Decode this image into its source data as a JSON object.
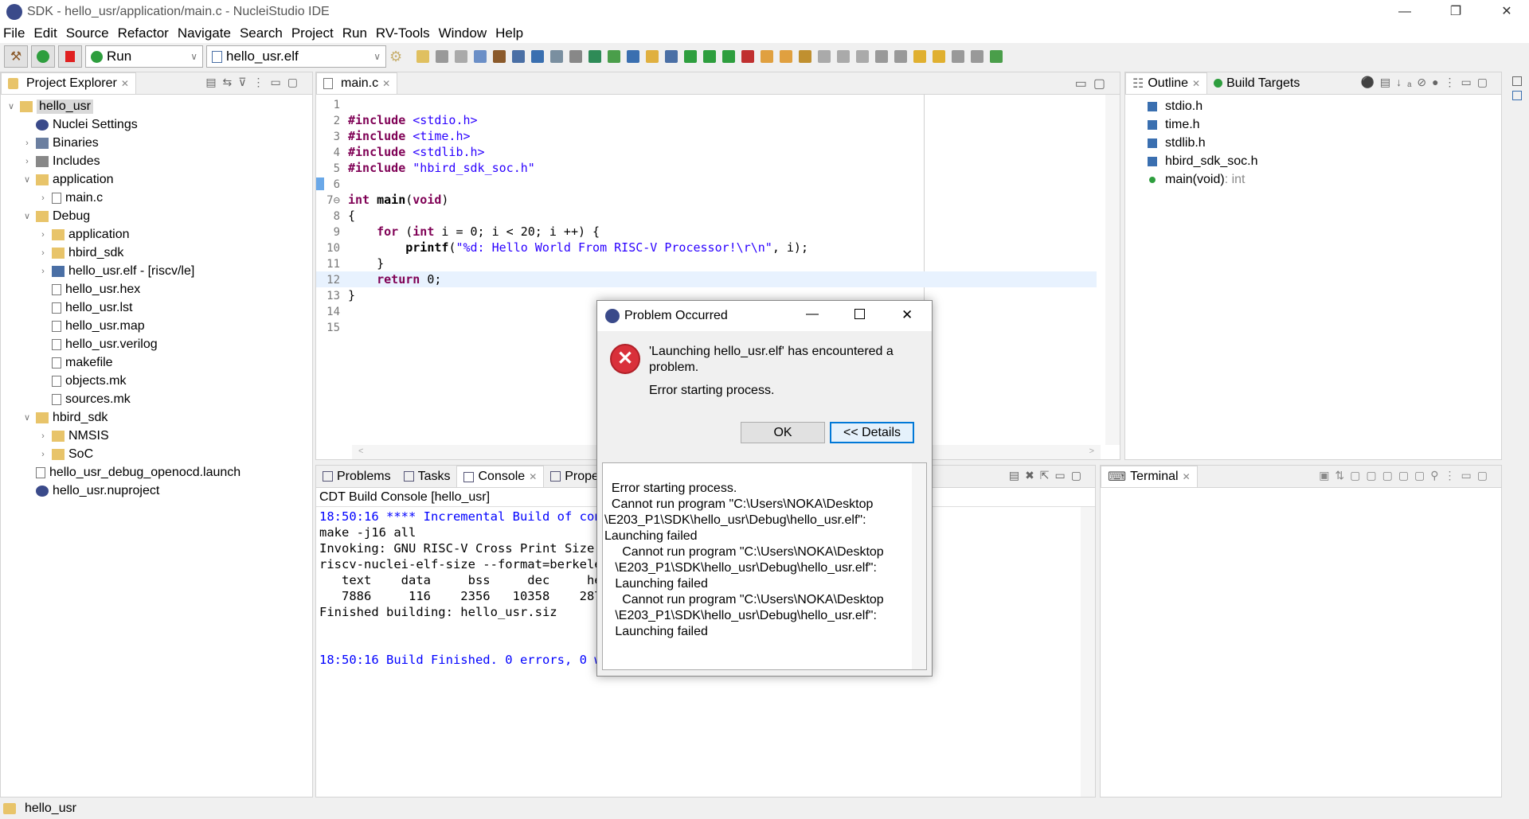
{
  "window": {
    "title": "SDK - hello_usr/application/main.c - NucleiStudio IDE",
    "min": "—",
    "max": "❐",
    "close": "✕"
  },
  "menu": [
    "File",
    "Edit",
    "Source",
    "Refactor",
    "Navigate",
    "Search",
    "Project",
    "Run",
    "RV-Tools",
    "Window",
    "Help"
  ],
  "toolbar": {
    "launch_mode": "Run",
    "launch_config": "hello_usr.elf"
  },
  "project_explorer": {
    "title": "Project Explorer",
    "items": [
      {
        "label": "hello_usr",
        "depth": 0,
        "chev": "v",
        "icon": "project",
        "selected": true
      },
      {
        "label": "Nuclei Settings",
        "depth": 1,
        "chev": "",
        "icon": "settings"
      },
      {
        "label": "Binaries",
        "depth": 1,
        "chev": ">",
        "icon": "binaries"
      },
      {
        "label": "Includes",
        "depth": 1,
        "chev": ">",
        "icon": "includes"
      },
      {
        "label": "application",
        "depth": 1,
        "chev": "v",
        "icon": "folder"
      },
      {
        "label": "main.c",
        "depth": 2,
        "chev": ">",
        "icon": "cfile"
      },
      {
        "label": "Debug",
        "depth": 1,
        "chev": "v",
        "icon": "folder"
      },
      {
        "label": "application",
        "depth": 2,
        "chev": ">",
        "icon": "folder"
      },
      {
        "label": "hbird_sdk",
        "depth": 2,
        "chev": ">",
        "icon": "folder"
      },
      {
        "label": "hello_usr.elf - [riscv/le]",
        "depth": 2,
        "chev": ">",
        "icon": "elf"
      },
      {
        "label": "hello_usr.hex",
        "depth": 2,
        "chev": "",
        "icon": "file"
      },
      {
        "label": "hello_usr.lst",
        "depth": 2,
        "chev": "",
        "icon": "file"
      },
      {
        "label": "hello_usr.map",
        "depth": 2,
        "chev": "",
        "icon": "file"
      },
      {
        "label": "hello_usr.verilog",
        "depth": 2,
        "chev": "",
        "icon": "file"
      },
      {
        "label": "makefile",
        "depth": 2,
        "chev": "",
        "icon": "makefile"
      },
      {
        "label": "objects.mk",
        "depth": 2,
        "chev": "",
        "icon": "makefile"
      },
      {
        "label": "sources.mk",
        "depth": 2,
        "chev": "",
        "icon": "makefile"
      },
      {
        "label": "hbird_sdk",
        "depth": 1,
        "chev": "v",
        "icon": "folder"
      },
      {
        "label": "NMSIS",
        "depth": 2,
        "chev": ">",
        "icon": "folder"
      },
      {
        "label": "SoC",
        "depth": 2,
        "chev": ">",
        "icon": "folder"
      },
      {
        "label": "hello_usr_debug_openocd.launch",
        "depth": 1,
        "chev": "",
        "icon": "file"
      },
      {
        "label": "hello_usr.nuproject",
        "depth": 1,
        "chev": "",
        "icon": "nuproject"
      }
    ]
  },
  "editor": {
    "tab": "main.c",
    "lines": [
      "",
      "<span class=\"kw\">#include</span> <span class=\"str\">&lt;stdio.h&gt;</span>",
      "<span class=\"kw\">#include</span> <span class=\"str\">&lt;time.h&gt;</span>",
      "<span class=\"kw\">#include</span> <span class=\"str\">&lt;stdlib.h&gt;</span>",
      "<span class=\"kw\">#include</span> <span class=\"str\">\"hbird_sdk_soc.h\"</span>",
      "",
      "<span class=\"kw\">int</span> <b>main</b>(<span class=\"kw\">void</span>)",
      "{",
      "    <span class=\"kw\">for</span> (<span class=\"kw\">int</span> i = 0; i &lt; 20; i ++) {",
      "        <b>printf</b>(<span class=\"str\">\"%d: Hello World From RISC-V Processor!\\r\\n\"</span>, i);",
      "    }",
      "    <span class=\"kw\">return</span> 0;",
      "}",
      "",
      ""
    ]
  },
  "outline": {
    "tabs": [
      "Outline",
      "Build Targets"
    ],
    "items": [
      {
        "label": "stdio.h",
        "detail": ""
      },
      {
        "label": "time.h",
        "detail": ""
      },
      {
        "label": "stdlib.h",
        "detail": ""
      },
      {
        "label": "hbird_sdk_soc.h",
        "detail": ""
      },
      {
        "label": "main(void)",
        "detail": " : int"
      }
    ]
  },
  "console": {
    "tabs": [
      "Problems",
      "Tasks",
      "Console",
      "Properties"
    ],
    "title": "CDT Build Console [hello_usr]",
    "lines": [
      {
        "t": "18:50:16 **** Incremental Build of configuration Debug for project hello_usr ****",
        "blue": true
      },
      {
        "t": "make -j16 all"
      },
      {
        "t": "Invoking: GNU RISC-V Cross Print Size"
      },
      {
        "t": "riscv-nuclei-elf-size --format=berkeley \"hello_usr.elf\""
      },
      {
        "t": "   text    data     bss     dec     hex filename"
      },
      {
        "t": "   7886     116    2356   10358    2876 hello_usr.elf"
      },
      {
        "t": "Finished building: hello_usr.siz"
      },
      {
        "t": ""
      },
      {
        "t": ""
      },
      {
        "t": "18:50:16 Build Finished. 0 errors, 0 warnings. (took 390ms)",
        "blue": true
      }
    ]
  },
  "terminal": {
    "tab": "Terminal"
  },
  "status": {
    "text": "hello_usr"
  },
  "dialog": {
    "title": "Problem Occurred",
    "message": "'Launching hello_usr.elf' has encountered a problem.",
    "detail": "Error starting process.",
    "ok": "OK",
    "details": "<< Details",
    "details_text": "Error starting process.\n  Cannot run program \"C:\\Users\\NOKA\\Desktop\n\\E203_P1\\SDK\\hello_usr\\Debug\\hello_usr.elf\":\nLaunching failed\n     Cannot run program \"C:\\Users\\NOKA\\Desktop\n   \\E203_P1\\SDK\\hello_usr\\Debug\\hello_usr.elf\":\n   Launching failed\n     Cannot run program \"C:\\Users\\NOKA\\Desktop\n   \\E203_P1\\SDK\\hello_usr\\Debug\\hello_usr.elf\":\n   Launching failed"
  },
  "colors": {
    "accent": "#1e90ff",
    "error": "#d9303a",
    "keyword": "#7f0055",
    "string": "#2a00ff",
    "console_blue": "#0000ff"
  }
}
